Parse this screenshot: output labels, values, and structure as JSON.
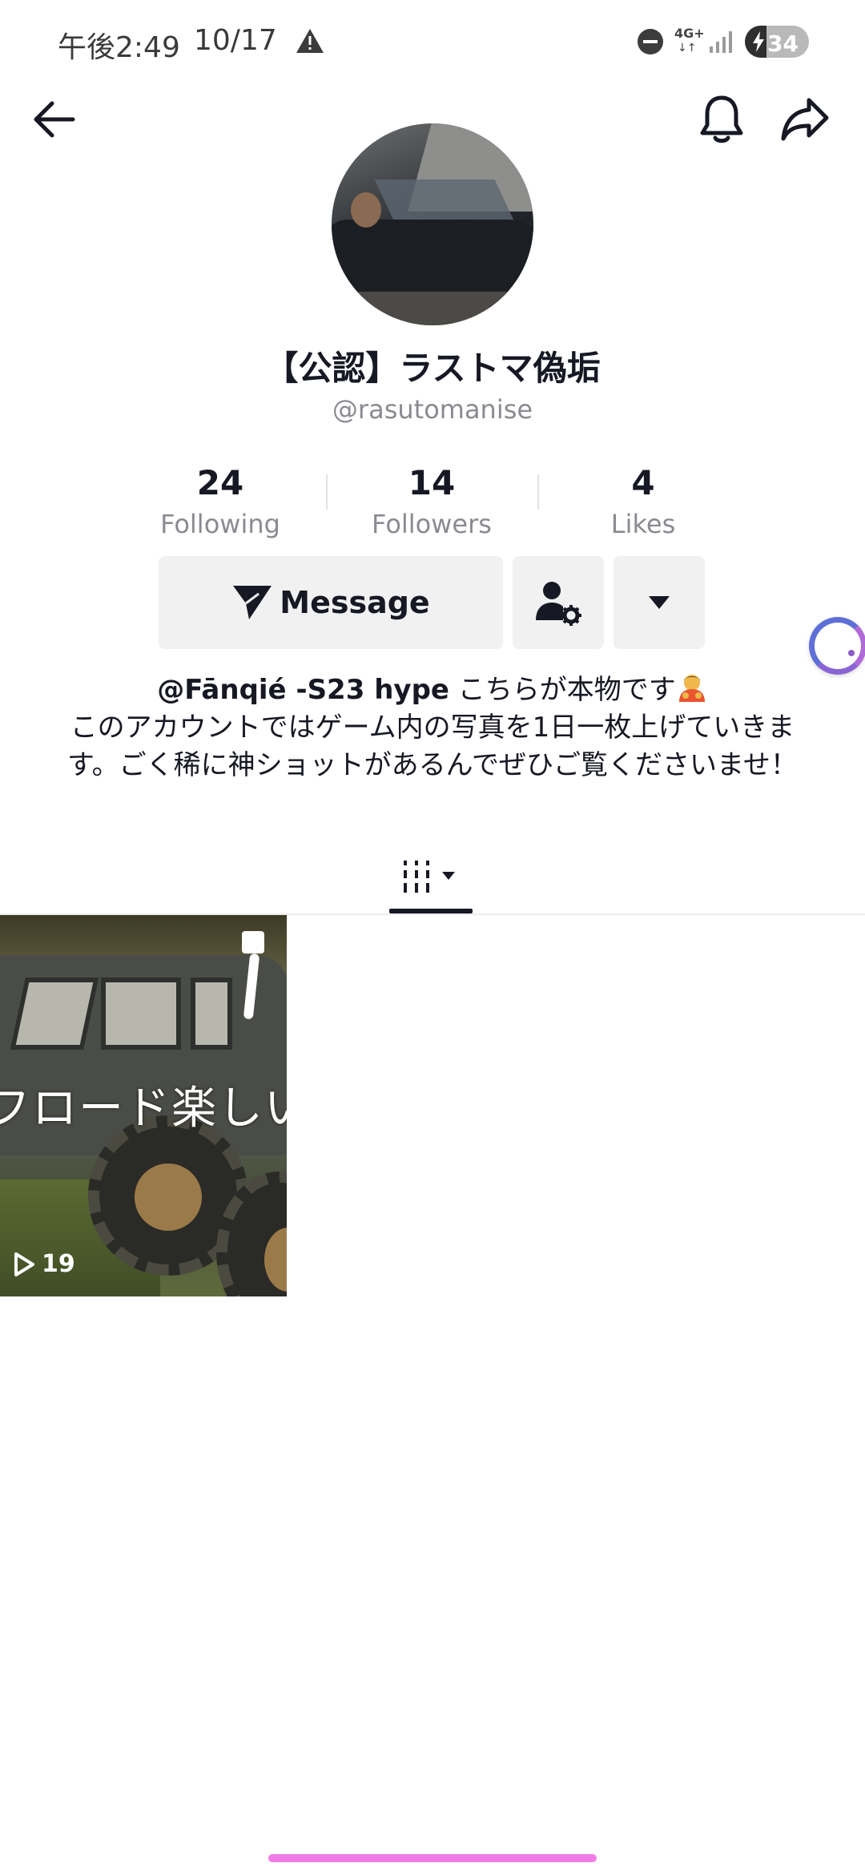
{
  "status_bar": {
    "time": "午後2:49",
    "date": "10/17",
    "network": "4G+",
    "network_arrows": "↓↑",
    "battery_level": 34,
    "battery_text": "34"
  },
  "nav": {
    "back_icon": "arrow-left-icon",
    "bell_icon": "bell-icon",
    "share_icon": "share-arrow-icon"
  },
  "profile": {
    "display_name": "【公認】ラストマ偽垢",
    "username": "@rasutomanise"
  },
  "stats": {
    "following_count": "24",
    "following_label": "Following",
    "followers_count": "14",
    "followers_label": "Followers",
    "likes_count": "4",
    "likes_label": "Likes"
  },
  "actions": {
    "message_label": "Message",
    "message_icon": "send-icon",
    "friends_icon": "user-settings-icon",
    "more_icon": "triangle-down-icon"
  },
  "bio": {
    "mention": "@Fānqié -S23 hype",
    "line1_rest": " こちらが本物です",
    "emoji": "🙇",
    "body": "このアカウントではゲーム内の写真を1日一枚上げていきます。ごく稀に神ショットがあるんでぜひご覧くださいませ！"
  },
  "tabs": {
    "videos_icon": "grid-sort-icon"
  },
  "videos": [
    {
      "caption": "フロード楽しい",
      "views": "19"
    }
  ],
  "colors": {
    "primary_text": "#161823",
    "secondary_text": "#8a8b91",
    "button_bg": "#f1f1f2",
    "home_indicator": "#f27ce6"
  }
}
